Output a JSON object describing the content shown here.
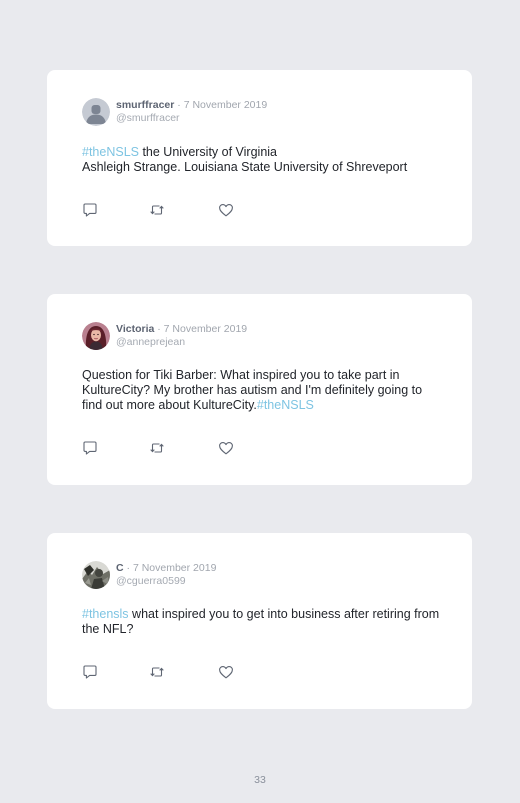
{
  "tweets": [
    {
      "name": "smurffracer",
      "separator": "·",
      "date": "7 November 2019",
      "handle": "@smurffracer",
      "avatar_icon": "default-user-icon",
      "text": {
        "hashtag_start": "#theNSLS",
        "line1_rest": " the University of Virginia",
        "line2": "Ashleigh Strange. Louisiana State University of Shreveport"
      }
    },
    {
      "name": "Victoria",
      "separator": "·",
      "date": "7 November 2019",
      "handle": "@anneprejean",
      "avatar_icon": "user-photo",
      "text": {
        "body": "Question for Tiki Barber: What inspired you to take part in KultureCity? My brother has autism and I'm definitely going to find out more about KultureCity.",
        "hashtag_end": "#theNSLS"
      }
    },
    {
      "name": "C",
      "separator": "·",
      "date": "7 November 2019",
      "handle": "@cguerra0599",
      "avatar_icon": "user-photo",
      "text": {
        "hashtag_start": "#thensls",
        "body": " what inspired you to get into business after retiring from the NFL?"
      }
    }
  ],
  "action_icons": [
    "reply-icon",
    "retweet-icon",
    "like-icon"
  ],
  "colors": {
    "background": "#e9eaee",
    "card": "#ffffff",
    "hashtag": "#7ec4e2",
    "name": "#5d6472",
    "muted": "#a1a6ae",
    "text": "#22252b"
  },
  "page_number": "33"
}
